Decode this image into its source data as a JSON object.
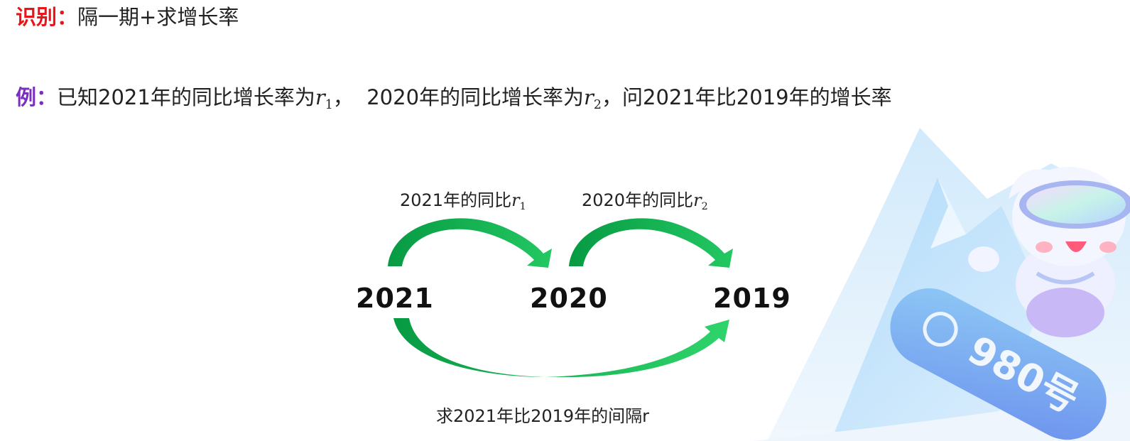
{
  "header": {
    "identify_tag": "识别：",
    "identify_text": "隔一期+求增长率"
  },
  "example": {
    "tag": "例：",
    "part1": "已知2021年的同比增长率为",
    "r1_base": "r",
    "r1_sub": "1",
    "sep": "，",
    "part2": "2020年的同比增长率为",
    "r2_base": "r",
    "r2_sub": "2",
    "part3": "，问2021年比2019年的增长率"
  },
  "diagram": {
    "label_top_left": "2021年的同比",
    "label_top_left_var": "r",
    "label_top_left_sub": "1",
    "label_top_right": "2020年的同比",
    "label_top_right_var": "r",
    "label_top_right_sub": "2",
    "year_left": "2021",
    "year_mid": "2020",
    "year_right": "2019",
    "label_bottom": "求2021年比2019年的间隔r"
  },
  "decoration": {
    "badge_text": "980号"
  },
  "colors": {
    "accent_red": "#e8161b",
    "accent_purple": "#7a2fc0",
    "arrow_green_dark": "#079a43",
    "arrow_green_light": "#1fc35f"
  }
}
